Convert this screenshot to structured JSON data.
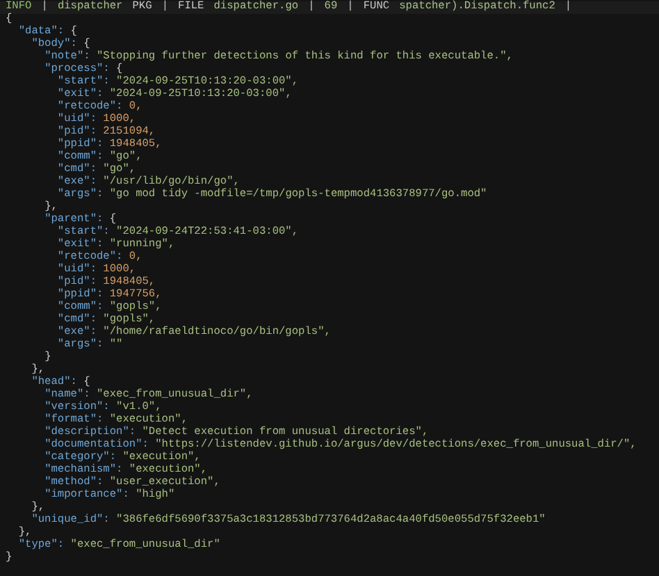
{
  "header": [
    {
      "text": "INFO",
      "kind": "level"
    },
    {
      "text": "|",
      "kind": "sep"
    },
    {
      "text": "dispatcher",
      "kind": "value"
    },
    {
      "text": "PKG",
      "kind": "label"
    },
    {
      "text": "|",
      "kind": "sep"
    },
    {
      "text": "FILE",
      "kind": "label"
    },
    {
      "text": "dispatcher.go",
      "kind": "value"
    },
    {
      "text": "|",
      "kind": "sep"
    },
    {
      "text": "69",
      "kind": "value"
    },
    {
      "text": "|",
      "kind": "sep"
    },
    {
      "text": "FUNC",
      "kind": "label"
    },
    {
      "text": "spatcher).Dispatch.func2",
      "kind": "value"
    },
    {
      "text": "|",
      "kind": "sep"
    }
  ],
  "document": {
    "open": "{",
    "close": "}",
    "entries": [
      {
        "key": "\"data\":",
        "kind": "object",
        "open": "{",
        "close": "},",
        "children": [
          {
            "key": "\"body\":",
            "kind": "object",
            "open": "{",
            "close": "},",
            "children": [
              {
                "key": "\"note\":",
                "kind": "string",
                "value": "\"Stopping further detections of this kind for this executable.\","
              },
              {
                "key": "\"process\":",
                "kind": "object",
                "open": "{",
                "close": "},",
                "children": [
                  {
                    "key": "\"start\":",
                    "kind": "string",
                    "value": "\"2024-09-25T10:13:20-03:00\","
                  },
                  {
                    "key": "\"exit\":",
                    "kind": "string",
                    "value": "\"2024-09-25T10:13:20-03:00\","
                  },
                  {
                    "key": "\"retcode\":",
                    "kind": "number",
                    "value": "0,"
                  },
                  {
                    "key": "\"uid\":",
                    "kind": "number",
                    "value": "1000,"
                  },
                  {
                    "key": "\"pid\":",
                    "kind": "number",
                    "value": "2151094,"
                  },
                  {
                    "key": "\"ppid\":",
                    "kind": "number",
                    "value": "1948405,"
                  },
                  {
                    "key": "\"comm\":",
                    "kind": "string",
                    "value": "\"go\","
                  },
                  {
                    "key": "\"cmd\":",
                    "kind": "string",
                    "value": "\"go\","
                  },
                  {
                    "key": "\"exe\":",
                    "kind": "string",
                    "value": "\"/usr/lib/go/bin/go\","
                  },
                  {
                    "key": "\"args\":",
                    "kind": "string",
                    "value": "\"go mod tidy -modfile=/tmp/gopls-tempmod4136378977/go.mod\""
                  }
                ]
              },
              {
                "key": "\"parent\":",
                "kind": "object",
                "open": "{",
                "close": "}",
                "children": [
                  {
                    "key": "\"start\":",
                    "kind": "string",
                    "value": "\"2024-09-24T22:53:41-03:00\","
                  },
                  {
                    "key": "\"exit\":",
                    "kind": "string",
                    "value": "\"running\","
                  },
                  {
                    "key": "\"retcode\":",
                    "kind": "number",
                    "value": "0,"
                  },
                  {
                    "key": "\"uid\":",
                    "kind": "number",
                    "value": "1000,"
                  },
                  {
                    "key": "\"pid\":",
                    "kind": "number",
                    "value": "1948405,"
                  },
                  {
                    "key": "\"ppid\":",
                    "kind": "number",
                    "value": "1947756,"
                  },
                  {
                    "key": "\"comm\":",
                    "kind": "string",
                    "value": "\"gopls\","
                  },
                  {
                    "key": "\"cmd\":",
                    "kind": "string",
                    "value": "\"gopls\","
                  },
                  {
                    "key": "\"exe\":",
                    "kind": "string",
                    "value": "\"/home/rafaeldtinoco/go/bin/gopls\","
                  },
                  {
                    "key": "\"args\":",
                    "kind": "string",
                    "value": "\"\""
                  }
                ]
              }
            ]
          },
          {
            "key": "\"head\":",
            "kind": "object",
            "open": "{",
            "close": "},",
            "children": [
              {
                "key": "\"name\":",
                "kind": "string",
                "value": "\"exec_from_unusual_dir\","
              },
              {
                "key": "\"version\":",
                "kind": "string",
                "value": "\"v1.0\","
              },
              {
                "key": "\"format\":",
                "kind": "string",
                "value": "\"execution\","
              },
              {
                "key": "\"description\":",
                "kind": "string",
                "value": "\"Detect execution from unusual directories\","
              },
              {
                "key": "\"documentation\":",
                "kind": "string",
                "value": "\"https://listendev.github.io/argus/dev/detections/exec_from_unusual_dir/\","
              },
              {
                "key": "\"category\":",
                "kind": "string",
                "value": "\"execution\","
              },
              {
                "key": "\"mechanism\":",
                "kind": "string",
                "value": "\"execution\","
              },
              {
                "key": "\"method\":",
                "kind": "string",
                "value": "\"user_execution\","
              },
              {
                "key": "\"importance\":",
                "kind": "string",
                "value": "\"high\""
              }
            ]
          },
          {
            "key": "\"unique_id\":",
            "kind": "string",
            "value": "\"386fe6df5690f3375a3c18312853bd773764d2a8ac4a40fd50e055d75f32eeb1\""
          }
        ]
      },
      {
        "key": "\"type\":",
        "kind": "string",
        "value": "\"exec_from_unusual_dir\""
      }
    ]
  }
}
